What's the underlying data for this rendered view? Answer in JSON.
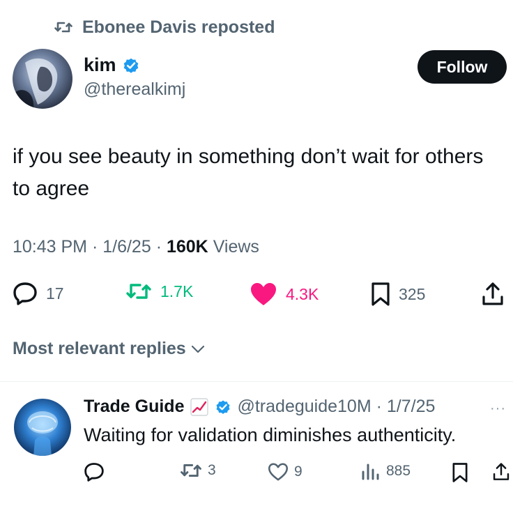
{
  "repost": {
    "label": "Ebonee Davis reposted",
    "icon": "repost-icon"
  },
  "author": {
    "name": "kim",
    "handle": "@therealkimj",
    "verified": true,
    "verified_color": "#1d9bf0"
  },
  "follow_label": "Follow",
  "post": {
    "text": "if you see beauty in something don’t wait for others to agree",
    "time": "10:43 PM",
    "date": "1/6/25",
    "views_count": "160K",
    "views_label": "Views"
  },
  "actions": {
    "replies": "17",
    "reposts": "1.7K",
    "likes": "4.3K",
    "bookmarks": "325",
    "repost_color": "#00ba7c",
    "like_color": "#f91880"
  },
  "replies_sort": "Most relevant replies",
  "reply": {
    "name": "Trade Guide",
    "handle": "@tradeguide10M",
    "date": "1/7/25",
    "text": "Waiting for validation diminishes authenticity.",
    "reposts": "3",
    "likes": "9",
    "views": "885",
    "more": "···"
  }
}
